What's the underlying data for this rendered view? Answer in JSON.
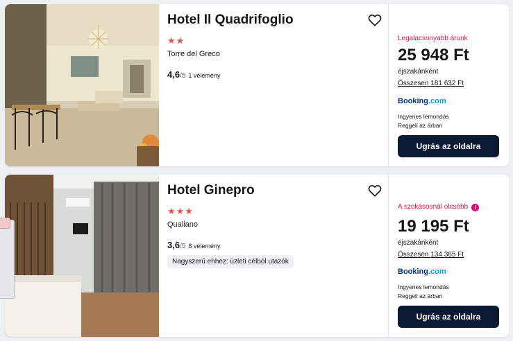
{
  "results": [
    {
      "name": "Hotel Il Quadrifoglio",
      "stars": "★★",
      "location": "Torre del Greco",
      "rating_score": "4,6",
      "rating_outof": "/5",
      "reviews": "1 vélemény",
      "price_label": "Legalacsonyabb árunk",
      "price": "25 948 Ft",
      "per_night": "éjszakánként",
      "total": "Összesen 181 632 Ft",
      "provider_main": "Booking",
      "provider_suffix": ".com",
      "perk_1": "Ingyenes lemondás",
      "perk_2": "Reggeli az árban",
      "cta": "Ugrás az oldalra",
      "favorite_icon": "heart-icon",
      "photo_icon": "hotel-lobby-photo"
    },
    {
      "name": "Hotel Ginepro",
      "stars": "★★★",
      "location": "Qualiano",
      "rating_score": "3,6",
      "rating_outof": "/5",
      "reviews": "8 vélemény",
      "tag": "Nagyszerű ehhez: üzleti célból utazók",
      "price_label": "A szokásosnál olcsóbb",
      "price_info_icon": "i",
      "price": "19 195 Ft",
      "per_night": "éjszakánként",
      "total": "Összesen 134 365 Ft",
      "provider_main": "Booking",
      "provider_suffix": ".com",
      "perk_1": "Ingyenes lemondás",
      "perk_2": "Reggeli az árban",
      "cta": "Ugrás az oldalra",
      "favorite_icon": "heart-icon",
      "photo_icon": "hotel-room-photo"
    }
  ],
  "colors": {
    "accent_red": "#e8504a",
    "price_label_pink": "#e8104b",
    "cta_bg": "#0a1a33",
    "booking_blue": "#003580",
    "booking_light": "#0a9ee0"
  }
}
